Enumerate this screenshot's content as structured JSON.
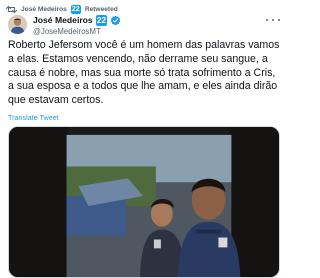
{
  "retweet": {
    "icon": "retweet-icon",
    "name": "José Medeiros",
    "badge": "22",
    "label": "Retweeted"
  },
  "author": {
    "display_name": "José Medeiros",
    "badge": "22",
    "verified_icon": "verified-badge-icon",
    "handle": "@JoseMedeirosMT"
  },
  "tweet": {
    "text": "Roberto Jefersom você é um homem das palavras vamos a elas. Estamos vencendo, não derrame seu sangue, a causa é nobre, mas sua morte só trata sofrimento a Cris, a sua esposa e a todos que lhe amam, e eles ainda dirão que estavam certos.",
    "translate_label": "Translate Tweet"
  },
  "media": {
    "type": "video-thumbnail"
  },
  "colors": {
    "accent": "#1d9bf0",
    "text": "#0f1419",
    "muted": "#536471"
  }
}
